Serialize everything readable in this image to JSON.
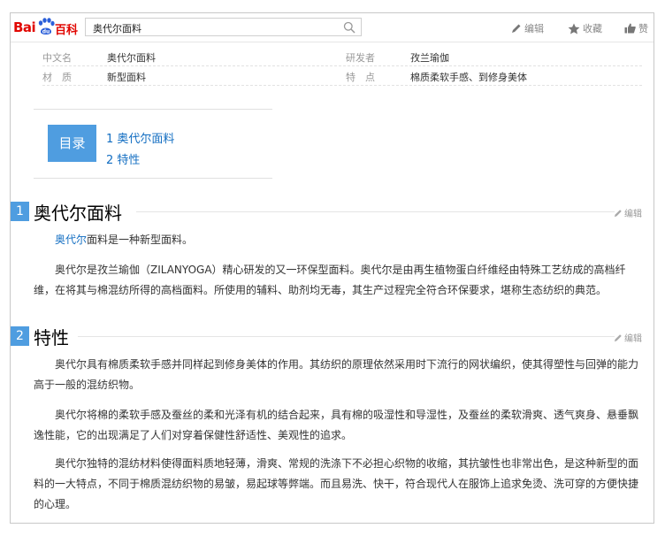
{
  "logo": {
    "bai": "Bai",
    "baike": "百科"
  },
  "search": {
    "value": "奥代尔面料"
  },
  "toolbar": {
    "edit": "编辑",
    "collect": "收藏",
    "like": "赞"
  },
  "basic_info": [
    [
      {
        "key": "中文名",
        "value": "奥代尔面料"
      },
      {
        "key": "研发者",
        "value": "孜兰瑜伽"
      }
    ],
    [
      {
        "key": "材　质",
        "value": "新型面料"
      },
      {
        "key": "特　点",
        "value": "棉质柔软手感、到修身美体"
      }
    ]
  ],
  "toc": {
    "badge": "目录",
    "items": [
      "1 奥代尔面料",
      "2 特性"
    ]
  },
  "sections": [
    {
      "num": "1",
      "title": "奥代尔面料",
      "edit": "编辑",
      "p1_link": "奥代尔",
      "p1_rest": "面料是一种新型面料。",
      "p2": "奥代尔是孜兰瑜伽（ZILANYOGA）精心研发的又一环保型面料。奥代尔是由再生植物蛋白纤维经由特殊工艺纺成的高档纤维，在将其与棉混纺所得的高档面料。所使用的辅料、助剂均无毒，其生产过程完全符合环保要求，堪称生态纺织的典范。"
    },
    {
      "num": "2",
      "title": "特性",
      "edit": "编辑",
      "p1": "奥代尔具有棉质柔软手感并同样起到修身美体的作用。其纺织的原理依然采用时下流行的网状编织，使其得塑性与回弹的能力高于一般的混纺织物。",
      "p2": "奥代尔将棉的柔软手感及蚕丝的柔和光泽有机的结合起来，具有棉的吸湿性和导湿性，及蚕丝的柔软滑爽、透气爽身、悬垂飘逸性能，它的出现满足了人们对穿着保健性舒适性、美观性的追求。",
      "p3": "奥代尔独特的混纺材料使得面料质地轻薄，滑爽、常规的洗涤下不必担心织物的收缩，其抗皱性也非常出色，是这种新型的面料的一大特点，不同于棉质混纺织物的易皱，易起球等弊端。而且易洗、快干，符合现代人在服饰上追求免烫、洗可穿的方便快捷的心理。"
    }
  ],
  "colors": {
    "brand_red": "#e10601",
    "accent_blue": "#4f9de0",
    "link_blue": "#136ec2"
  }
}
